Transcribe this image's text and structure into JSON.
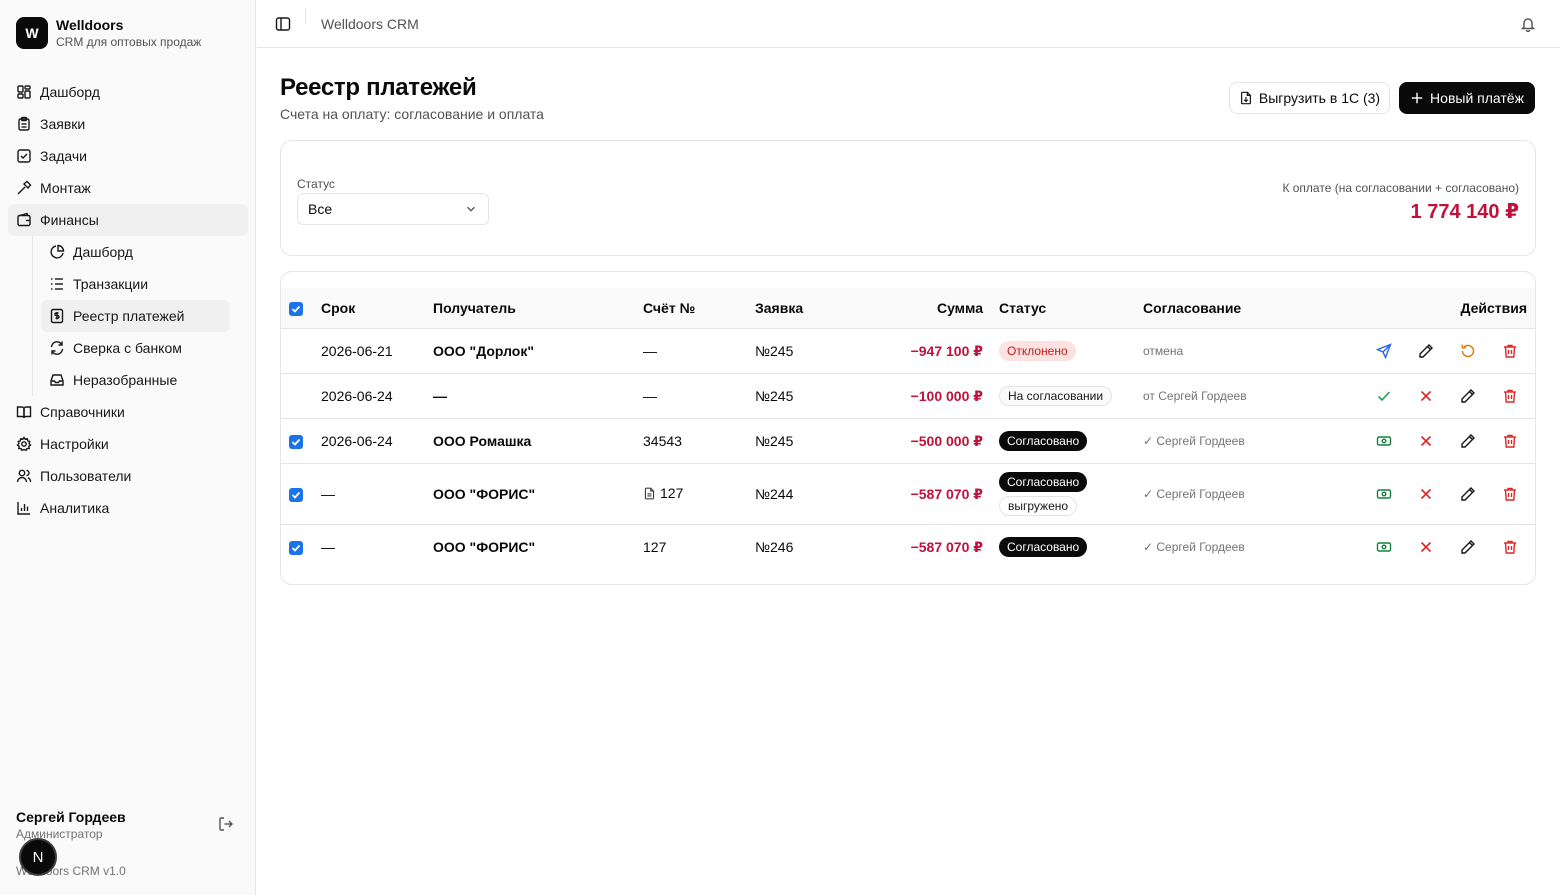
{
  "brand": {
    "logo_letter": "W",
    "name": "Welldoors",
    "subtitle": "CRM для оптовых продаж"
  },
  "nav": {
    "items": [
      {
        "label": "Дашборд",
        "icon": "dashboard-icon"
      },
      {
        "label": "Заявки",
        "icon": "clipboard-icon"
      },
      {
        "label": "Задачи",
        "icon": "check-square-icon"
      },
      {
        "label": "Монтаж",
        "icon": "hammer-icon"
      },
      {
        "label": "Финансы",
        "icon": "wallet-icon"
      },
      {
        "label": "Справочники",
        "icon": "book-icon"
      },
      {
        "label": "Настройки",
        "icon": "gear-icon"
      },
      {
        "label": "Пользователи",
        "icon": "users-icon"
      },
      {
        "label": "Аналитика",
        "icon": "bar-chart-icon"
      }
    ],
    "finance_sub": [
      {
        "label": "Дашборд",
        "icon": "pie-chart-icon"
      },
      {
        "label": "Транзакции",
        "icon": "list-icon"
      },
      {
        "label": "Реестр платежей",
        "icon": "receipt-icon"
      },
      {
        "label": "Сверка с банком",
        "icon": "refresh-icon"
      },
      {
        "label": "Неразобранные",
        "icon": "inbox-icon"
      }
    ]
  },
  "user": {
    "name": "Сергей Гордеев",
    "role": "Администратор",
    "avatar_letter": "N"
  },
  "version": "Welldoors CRM v1.0",
  "topbar": {
    "title": "Welldoors CRM"
  },
  "page": {
    "title": "Реестр платежей",
    "subtitle": "Счета на оплату: согласование и оплата",
    "export_label": "Выгрузить в 1С (3)",
    "new_label": "Новый платёж"
  },
  "filter": {
    "status_label": "Статус",
    "status_value": "Все",
    "total_label": "К оплате (на согласовании + согласовано)",
    "total_value": "1 774 140 ₽"
  },
  "table": {
    "headers": {
      "due": "Срок",
      "recipient": "Получатель",
      "invoice": "Счёт №",
      "request": "Заявка",
      "amount": "Сумма",
      "status": "Статус",
      "approval": "Согласование",
      "actions": "Действия"
    },
    "rows": [
      {
        "checked": false,
        "due": "2026-06-21",
        "recipient": "ООО \"Дорлок\"",
        "invoice": "—",
        "request": "№245",
        "amount": "−947 100 ₽",
        "status": "Отклонено",
        "approval": "отмена"
      },
      {
        "checked": false,
        "due": "2026-06-24",
        "recipient": "—",
        "invoice": "—",
        "request": "№245",
        "amount": "−100 000 ₽",
        "status": "На согласовании",
        "approval": "от Сергей Гордеев"
      },
      {
        "checked": true,
        "due": "2026-06-24",
        "recipient": "ООО Ромашка",
        "invoice": "34543",
        "request": "№245",
        "amount": "−500 000 ₽",
        "status": "Согласовано",
        "approval": "✓ Сергей Гордеев"
      },
      {
        "checked": true,
        "due": "—",
        "recipient": "ООО \"ФОРИС\"",
        "invoice": "127",
        "request": "№244",
        "amount": "−587 070 ₽",
        "status": "Согласовано",
        "status2": "выгружено",
        "approval": "✓ Сергей Гордеев"
      },
      {
        "checked": true,
        "due": "—",
        "recipient": "ООО \"ФОРИС\"",
        "invoice": "127",
        "request": "№246",
        "amount": "−587 070 ₽",
        "status": "Согласовано",
        "approval": "✓ Сергей Гордеев"
      }
    ]
  },
  "colors": {
    "accent": "#0a0a0a",
    "amount": "#be123c",
    "checkbox": "#1a73e8",
    "approve": "#16a34a",
    "reject": "#dc2626",
    "send": "#2563eb",
    "restore": "#d97706",
    "pay": "#15803d"
  }
}
